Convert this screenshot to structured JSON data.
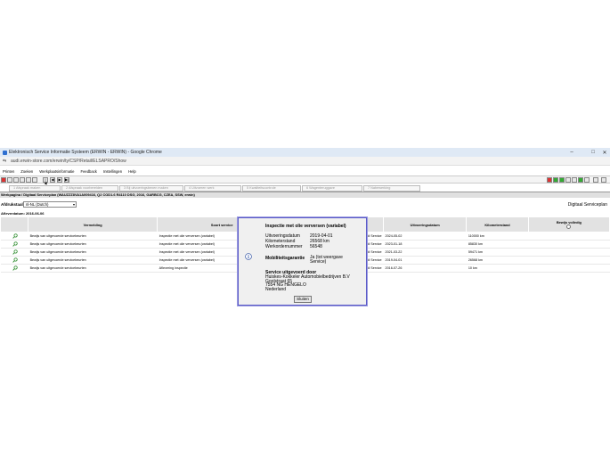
{
  "window": {
    "title": "Elektronisch Service Informatie Systeem (ERWIN - ERWIN) - Google Chrome",
    "url": "audi.erwin-store.com/erwin/ty/CSP/Retail/ELSAPRO/Show"
  },
  "menu": [
    "Printen",
    "Zoeken",
    "Werkplaatsinformatie",
    "Feedback",
    "Instellingen",
    "Help"
  ],
  "steps": [
    "1 Afspraak maken",
    "2 Afspraak voorbereiden",
    "3 Bij uitvoeringsbenen maken",
    "4 Uitvoeren werk",
    "5 Kwaliteitscontrole",
    "6 Wagenteruggave",
    "7 Nabewerking"
  ],
  "vehicle_line": "Werkpagina / Digitaal Serviceplan (WAUZZZ8VA1A009416, Q2 COD1.6 R4110 DSG, 2016, GARBCG, CZEA, SSW, erwin)",
  "filter": {
    "label": "Afdrukstaal:",
    "value": "nl-NL (Dutch)",
    "right_title": "Digitaal Serviceplan"
  },
  "afleverdatum": "Afleverdatum: 2016-06-06",
  "table": {
    "headers": [
      "",
      "Vermelding",
      "Soort service",
      "",
      "Uitvoeringsdatum",
      "Kilometerstand",
      "Bewijs volledig"
    ],
    "rows": [
      {
        "vermelding": "Bewijs van uitgevoerde servicebeurten",
        "soort": "Inspectie met olie verversen (variabel)",
        "type": "Audi Service",
        "datum": "2024-05-02",
        "km": "110000 km"
      },
      {
        "vermelding": "Bewijs van uitgevoerde servicebeurten",
        "soort": "Inspectie met olie verversen (variabel)",
        "type": "Audi Service",
        "datum": "2023-01-18",
        "km": "85830 km"
      },
      {
        "vermelding": "Bewijs van uitgevoerde servicebeurten",
        "soort": "Inspectie met olie verversen (variabel)",
        "type": "Audi Service",
        "datum": "2021-03-22",
        "km": "59471 km"
      },
      {
        "vermelding": "Bewijs van uitgevoerde servicebeurten",
        "soort": "Inspectie met olie verversen (variabel)",
        "type": "Audi Service",
        "datum": "2019-04-01",
        "km": "26568 km"
      },
      {
        "vermelding": "Bewijs van uitgevoerde servicebeurten",
        "soort": "Aflevering inspectie",
        "type": "Audi Service",
        "datum": "2016-07-26",
        "km": "10 km"
      }
    ]
  },
  "dialog": {
    "title": "Inspectie met olie verversen (variabel)",
    "fields": [
      {
        "label": "Uitvoeringsdatum",
        "value": "2019-04-01"
      },
      {
        "label": "Kilometerstand",
        "value": "26568 km"
      },
      {
        "label": "Werkordernummer",
        "value": "56548"
      }
    ],
    "mobility_label": "Mobiliteitsgarantie",
    "mobility_value": "Ja (tot weergave Service)",
    "service_by": "Service uitgevoerd door",
    "address": [
      "Huiskes-Kokkeler Automobielbedrijven B.V",
      "Goolstraat 65",
      "7554 NG HENGELO",
      "Nederland"
    ],
    "close": "Sluiten"
  }
}
